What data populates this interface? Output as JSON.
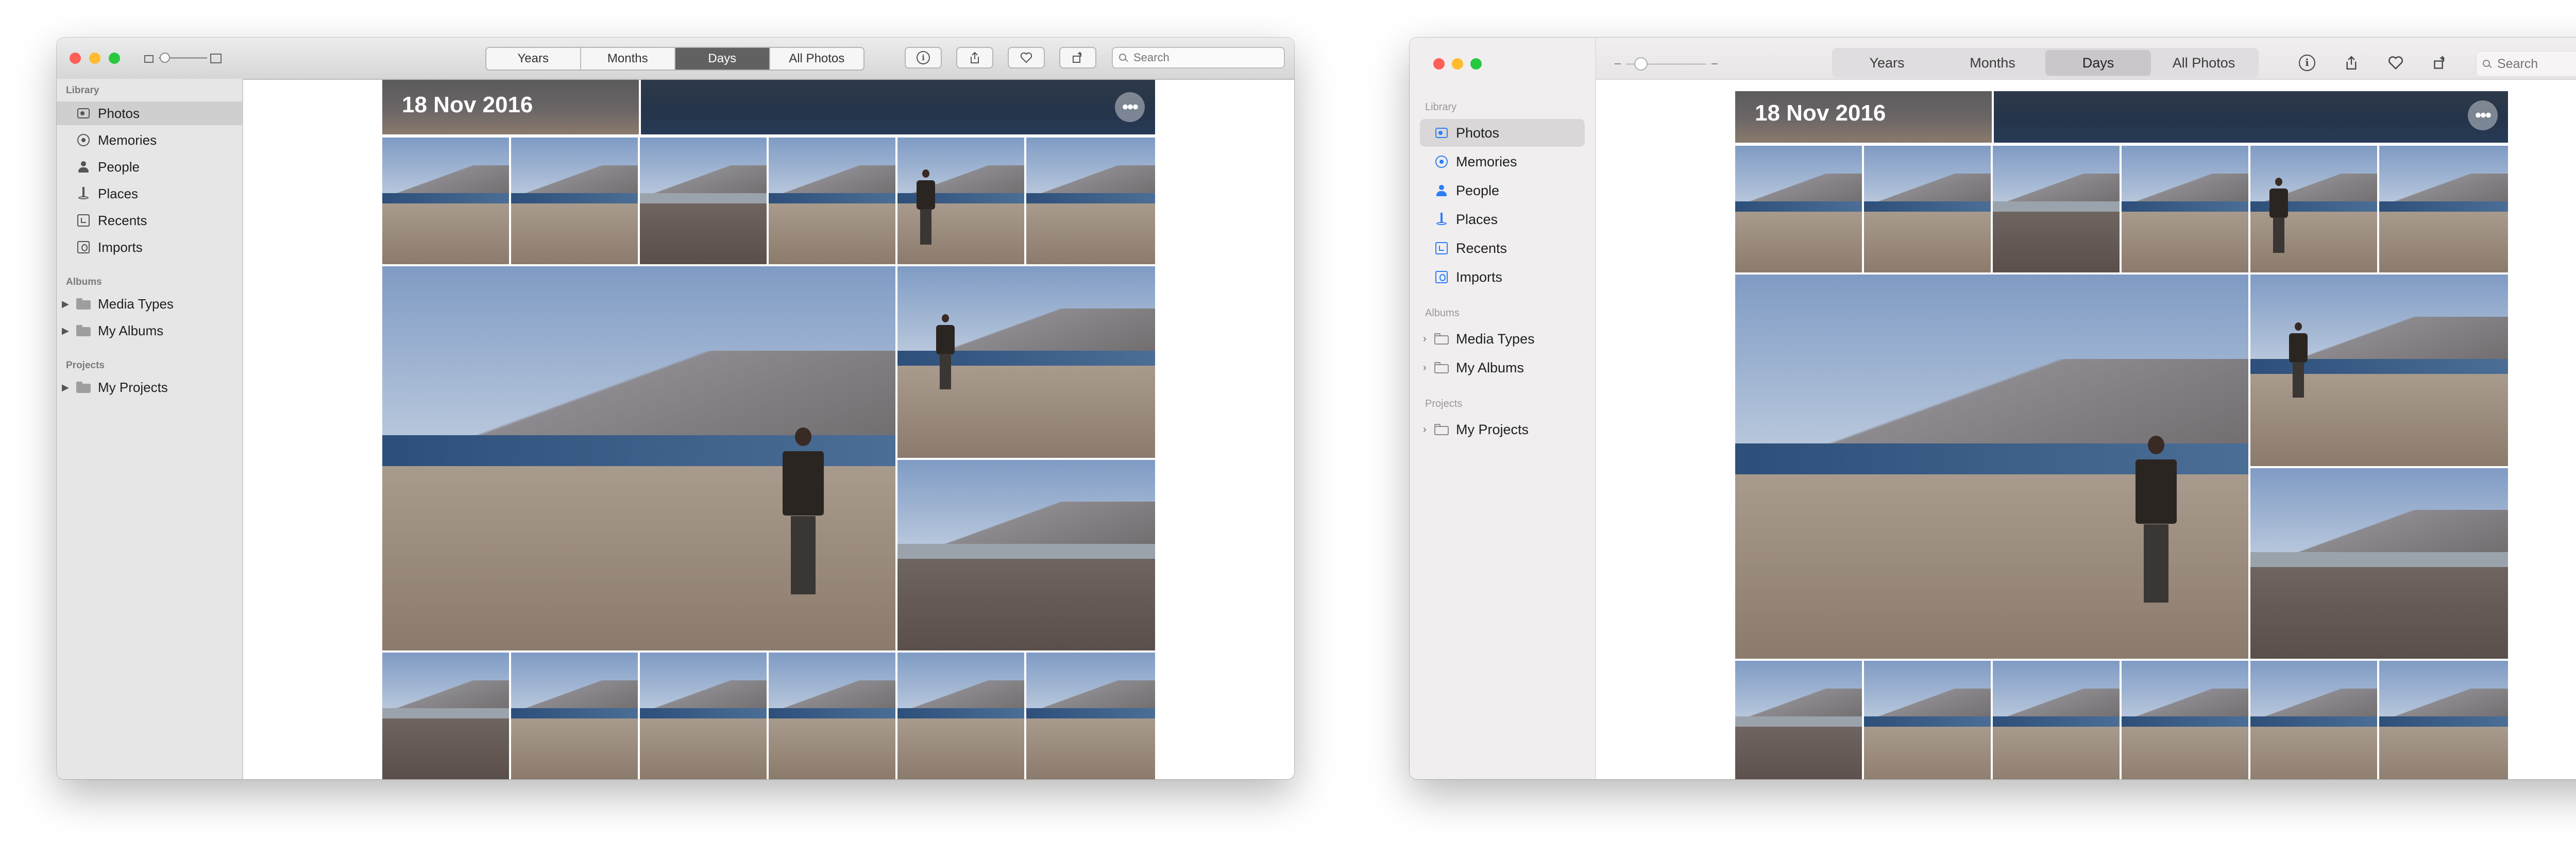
{
  "windows": [
    {
      "search": {
        "placeholder": "Search"
      },
      "tabs": [
        {
          "label": "Years",
          "active": false
        },
        {
          "label": "Months",
          "active": false
        },
        {
          "label": "Days",
          "active": true
        },
        {
          "label": "All Photos",
          "active": false
        }
      ],
      "toolbar_buttons": [
        "info-icon",
        "share-icon",
        "heart-icon",
        "rotate-icon"
      ],
      "sidebar": {
        "sections": [
          {
            "title": "Library",
            "items": [
              {
                "label": "Photos",
                "icon": "photos-icon",
                "selected": true
              },
              {
                "label": "Memories",
                "icon": "memories-icon"
              },
              {
                "label": "People",
                "icon": "people-icon"
              },
              {
                "label": "Places",
                "icon": "places-icon"
              },
              {
                "label": "Recents",
                "icon": "recents-icon"
              },
              {
                "label": "Imports",
                "icon": "imports-icon"
              }
            ]
          },
          {
            "title": "Albums",
            "items": [
              {
                "label": "Media Types",
                "icon": "folder-icon",
                "disclosure": true
              },
              {
                "label": "My Albums",
                "icon": "folder-icon",
                "disclosure": true
              }
            ]
          },
          {
            "title": "Projects",
            "items": [
              {
                "label": "My Projects",
                "icon": "folder-icon",
                "disclosure": true
              }
            ]
          }
        ]
      },
      "day": {
        "title": "18 Nov 2016"
      }
    },
    {
      "search": {
        "placeholder": "Search"
      },
      "tabs": [
        {
          "label": "Years",
          "active": false
        },
        {
          "label": "Months",
          "active": false
        },
        {
          "label": "Days",
          "active": true
        },
        {
          "label": "All Photos",
          "active": false
        }
      ],
      "toolbar_buttons": [
        "info-icon",
        "share-icon",
        "heart-icon",
        "rotate-icon"
      ],
      "sidebar": {
        "sections": [
          {
            "title": "Library",
            "items": [
              {
                "label": "Photos",
                "icon": "photos-icon",
                "selected": true
              },
              {
                "label": "Memories",
                "icon": "memories-icon"
              },
              {
                "label": "People",
                "icon": "people-icon"
              },
              {
                "label": "Places",
                "icon": "places-icon"
              },
              {
                "label": "Recents",
                "icon": "recents-icon"
              },
              {
                "label": "Imports",
                "icon": "imports-icon"
              }
            ]
          },
          {
            "title": "Albums",
            "items": [
              {
                "label": "Media Types",
                "icon": "folder-icon",
                "disclosure": true
              },
              {
                "label": "My Albums",
                "icon": "folder-icon",
                "disclosure": true
              }
            ]
          },
          {
            "title": "Projects",
            "items": [
              {
                "label": "My Projects",
                "icon": "folder-icon",
                "disclosure": true
              }
            ]
          }
        ]
      },
      "day": {
        "title": "18 Nov 2016"
      }
    }
  ],
  "colors": {
    "selected_tab_classic": "#616161",
    "sidebar_icon_bigsur": "#2c7ef8",
    "traffic_red": "#fe5f57",
    "traffic_yellow": "#febc2e",
    "traffic_green": "#28c840"
  }
}
